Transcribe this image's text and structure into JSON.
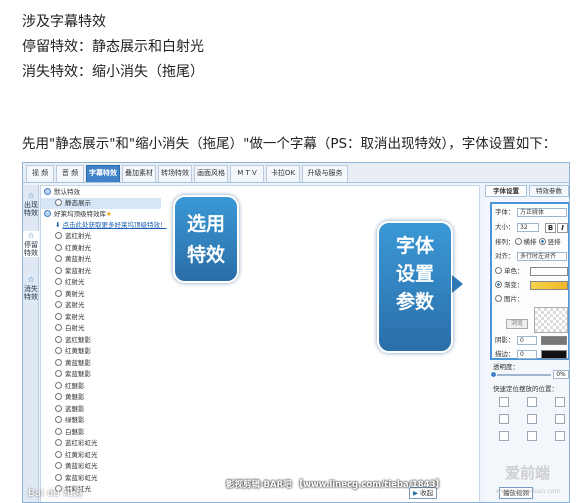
{
  "intro": {
    "line1": "涉及字幕特效",
    "line2": "停留特效：静态展示和白射光",
    "line3": "消失特效：缩小消失（拖尾）"
  },
  "lead": "先用\"静态展示\"和\"缩小消失（拖尾）\"做一个字幕（PS：取消出现特效），字体设置如下：",
  "app": {
    "tabs": [
      "视 频",
      "音 频",
      "字幕特效",
      "叠加素材",
      "转场特效",
      "画面风格",
      "M T V",
      "卡拉OK",
      "升级与服务"
    ],
    "right_tabs": [
      "字体设置",
      "特效参数"
    ],
    "side_nav": [
      "出现特效",
      "停留特效",
      "消失特效"
    ],
    "list": {
      "section1": "默认特效",
      "item_selected": "静态展示",
      "section2": "好莱坞顶级特效库",
      "link": "点击此处获取更多好莱坞顶级特效！",
      "items": [
        "蓝红射光",
        "红黄射光",
        "黄蓝射光",
        "紫蓝射光",
        "红射光",
        "黄射光",
        "蓝射光",
        "紫射光",
        "白射光",
        "蓝红魅影",
        "红黄魅影",
        "黄蓝魅影",
        "紫蓝魅影",
        "红魅影",
        "黄魅影",
        "蓝魅影",
        "绿魅影",
        "白魅影",
        "蓝红彩虹光",
        "红黄彩虹光",
        "黄蓝彩虹光",
        "紫蓝彩虹光",
        "红彩虹光"
      ]
    },
    "font_panel": {
      "font_label": "字体：",
      "font_value": "方正姚体",
      "size_label": "大小：",
      "size_value": "32",
      "bold": "B",
      "italic": "I",
      "arrange_label": "排列：",
      "horizontal": "横排",
      "vertical": "竖排",
      "align_label": "对齐：",
      "align_value": "多行时左对齐",
      "single_color": "单色：",
      "gradient": "渐变：",
      "picture": "图片：",
      "browse": "浏览",
      "shadow_label": "阴影：",
      "shadow_value": "0",
      "outline_label": "描边：",
      "outline_value": "0",
      "opacity_label": "透明度：",
      "opacity_value": "0%",
      "position_label": "快速定位摆放的位置："
    },
    "bottom_buttons": [
      "收起",
      "播放视频"
    ]
  },
  "callouts": {
    "select_effect": [
      "选用",
      "特效"
    ],
    "font_settings": [
      "字体",
      "设置",
      "参数"
    ]
  },
  "watermark": {
    "footer_text": "影视剪辑-BAR吧 【www.linecg.com/tieba/1843】",
    "baidu": "Bai du 知道",
    "site": "爱前端",
    "site_url": "www.aiqianduan.com"
  },
  "colors": {
    "accent": "#3f82c8",
    "callout": "#2a7dbf",
    "border": "#8fb3d6"
  }
}
